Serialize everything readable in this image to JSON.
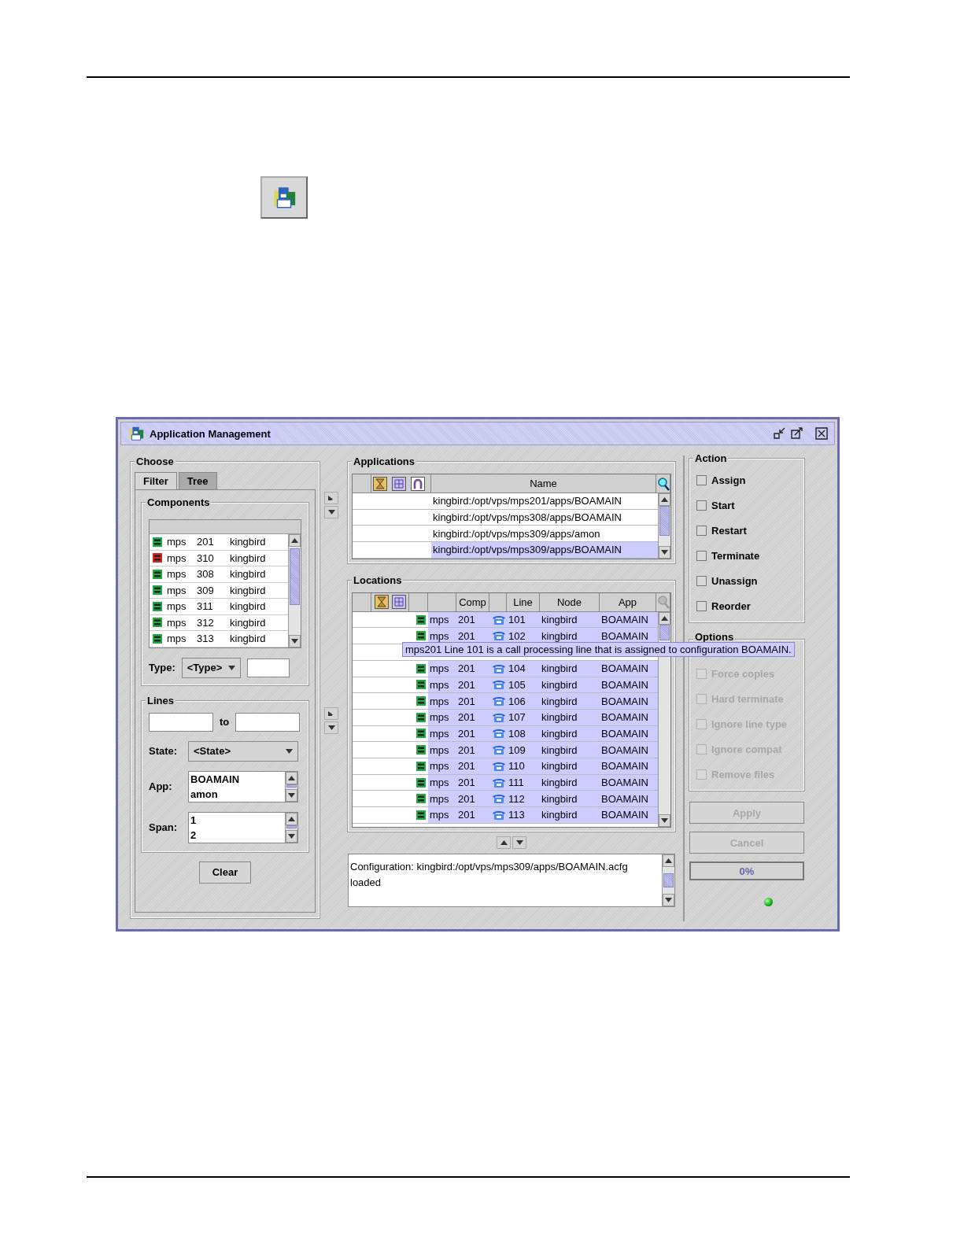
{
  "window": {
    "title": "Application Management"
  },
  "choose": {
    "title": "Choose",
    "tabs": [
      {
        "label": "Filter",
        "selected": true
      },
      {
        "label": "Tree",
        "selected": false
      }
    ],
    "components": {
      "title": "Components",
      "items": [
        {
          "type": "mps",
          "number": "201",
          "node": "kingbird",
          "color": "#22aa44"
        },
        {
          "type": "mps",
          "number": "310",
          "node": "kingbird",
          "color": "#dd2222"
        },
        {
          "type": "mps",
          "number": "308",
          "node": "kingbird",
          "color": "#22aa44"
        },
        {
          "type": "mps",
          "number": "309",
          "node": "kingbird",
          "color": "#22aa44"
        },
        {
          "type": "mps",
          "number": "311",
          "node": "kingbird",
          "color": "#22aa44"
        },
        {
          "type": "mps",
          "number": "312",
          "node": "kingbird",
          "color": "#22aa44"
        },
        {
          "type": "mps",
          "number": "313",
          "node": "kingbird",
          "color": "#22aa44"
        }
      ],
      "type_label": "Type:",
      "type_value": "<Type>"
    },
    "lines": {
      "title": "Lines",
      "to_label": "to",
      "state_label": "State:",
      "state_value": "<State>",
      "app_label": "App:",
      "app_values": [
        "BOAMAIN",
        "amon"
      ],
      "span_label": "Span:",
      "span_values": [
        "1",
        "2"
      ]
    },
    "clear_button": "Clear"
  },
  "applications": {
    "title": "Applications",
    "column": "Name",
    "rows": [
      {
        "name": "kingbird:/opt/vps/mps201/apps/BOAMAIN",
        "selected": false
      },
      {
        "name": "kingbird:/opt/vps/mps308/apps/BOAMAIN",
        "selected": false
      },
      {
        "name": "kingbird:/opt/vps/mps309/apps/amon",
        "selected": false
      },
      {
        "name": "kingbird:/opt/vps/mps309/apps/BOAMAIN",
        "selected": true
      }
    ]
  },
  "locations": {
    "title": "Locations",
    "columns": [
      "Comp",
      "Line",
      "Node",
      "App"
    ],
    "rows": [
      {
        "kind": "row",
        "component": "mps",
        "number": "201",
        "line": "101",
        "node": "kingbird",
        "app": "BOAMAIN",
        "selected": true
      },
      {
        "kind": "row",
        "component": "mps",
        "number": "201",
        "line": "102",
        "node": "kingbird",
        "app": "BOAMAIN",
        "selected": true
      },
      {
        "kind": "covered"
      },
      {
        "kind": "row",
        "component": "mps",
        "number": "201",
        "line": "104",
        "node": "kingbird",
        "app": "BOAMAIN",
        "selected": true
      },
      {
        "kind": "row",
        "component": "mps",
        "number": "201",
        "line": "105",
        "node": "kingbird",
        "app": "BOAMAIN",
        "selected": true
      },
      {
        "kind": "row",
        "component": "mps",
        "number": "201",
        "line": "106",
        "node": "kingbird",
        "app": "BOAMAIN",
        "selected": true
      },
      {
        "kind": "row",
        "component": "mps",
        "number": "201",
        "line": "107",
        "node": "kingbird",
        "app": "BOAMAIN",
        "selected": true
      },
      {
        "kind": "row",
        "component": "mps",
        "number": "201",
        "line": "108",
        "node": "kingbird",
        "app": "BOAMAIN",
        "selected": true
      },
      {
        "kind": "row",
        "component": "mps",
        "number": "201",
        "line": "109",
        "node": "kingbird",
        "app": "BOAMAIN",
        "selected": true
      },
      {
        "kind": "row",
        "component": "mps",
        "number": "201",
        "line": "110",
        "node": "kingbird",
        "app": "BOAMAIN",
        "selected": true
      },
      {
        "kind": "row",
        "component": "mps",
        "number": "201",
        "line": "111",
        "node": "kingbird",
        "app": "BOAMAIN",
        "selected": true
      },
      {
        "kind": "row",
        "component": "mps",
        "number": "201",
        "line": "112",
        "node": "kingbird",
        "app": "BOAMAIN",
        "selected": true
      },
      {
        "kind": "row",
        "component": "mps",
        "number": "201",
        "line": "113",
        "node": "kingbird",
        "app": "BOAMAIN",
        "selected": true
      }
    ],
    "tooltip": "mps201 Line 101 is  a call processing line that is assigned to configuration BOAMAIN."
  },
  "log": {
    "lines": [
      "Configuration: kingbird:/opt/vps/mps309/apps/BOAMAIN.acfg loaded"
    ]
  },
  "action": {
    "title": "Action",
    "items": [
      {
        "label": "Assign",
        "checked": false,
        "disabled": false
      },
      {
        "label": "Start",
        "checked": false,
        "disabled": false
      },
      {
        "label": "Restart",
        "checked": false,
        "disabled": false
      },
      {
        "label": "Terminate",
        "checked": false,
        "disabled": false
      },
      {
        "label": "Unassign",
        "checked": false,
        "disabled": false
      },
      {
        "label": "Reorder",
        "checked": false,
        "disabled": false
      }
    ]
  },
  "options": {
    "title": "Options",
    "items": [
      {
        "label": "Force copies",
        "checked": false,
        "disabled": true
      },
      {
        "label": "Hard terminate",
        "checked": false,
        "disabled": true
      },
      {
        "label": "Ignore line type",
        "checked": false,
        "disabled": true
      },
      {
        "label": "Ignore compat",
        "checked": false,
        "disabled": true
      },
      {
        "label": "Remove files",
        "checked": false,
        "disabled": true
      }
    ]
  },
  "buttons": [
    {
      "label": "Apply",
      "disabled": true
    },
    {
      "label": "Cancel",
      "disabled": true
    }
  ],
  "progress": {
    "label": "0%",
    "level": 0
  }
}
